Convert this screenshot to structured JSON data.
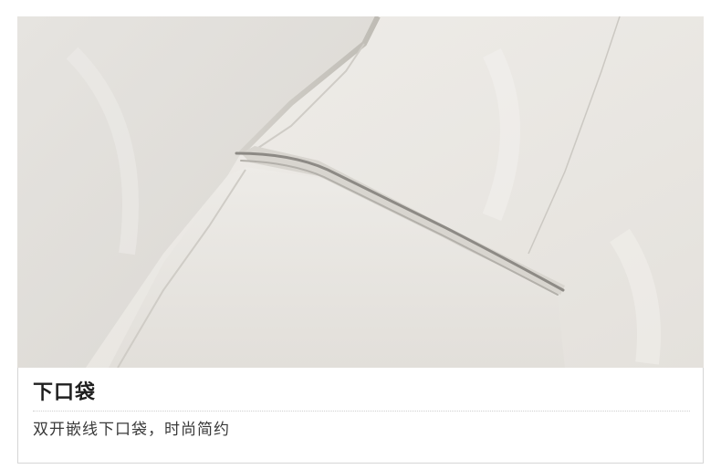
{
  "caption": {
    "title": "下口袋",
    "subtitle": "双开嵌线下口袋，时尚简约"
  },
  "photo": {
    "subject": "light-grey-fabric-welt-pocket",
    "colors": {
      "fabric_light": "#eceae6",
      "fabric_mid": "#dedbd6",
      "fabric_shadow": "#c9c6c0",
      "welt_dark": "#8d8a85"
    }
  }
}
